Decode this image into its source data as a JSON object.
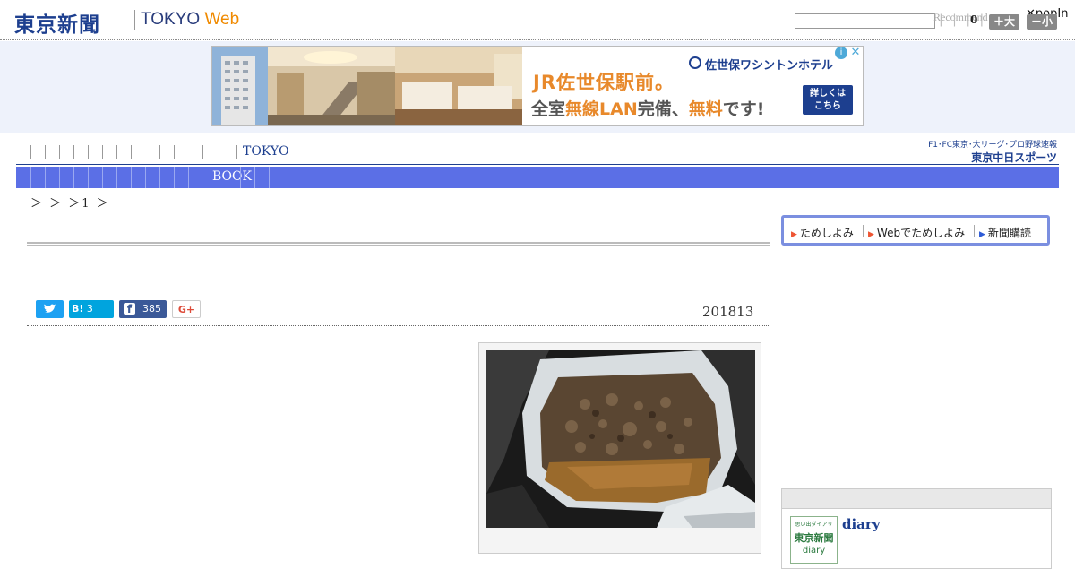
{
  "header": {
    "logo_text": "東京新聞",
    "logo_sub_main": "TOKYO ",
    "logo_sub_accent": "Web",
    "recommend_label": "Recommend",
    "recommend_count": "0",
    "popin_label": "popIn",
    "size_plus_label": "＋大",
    "size_minus_label": "－小"
  },
  "ad": {
    "title": "JR佐世保駅前。",
    "hotel_name": "佐世保ワシントンホテル",
    "line_prefix": "全室",
    "line_hl1": "無線LAN",
    "line_mid": "完備、",
    "line_hl2": "無料",
    "line_suffix": "です!",
    "more_line1": "詳しくは",
    "more_line2": "こちら",
    "choice_icon": "i",
    "close_icon": "✕"
  },
  "nav": {
    "tokyo_label": "TOKYO",
    "book_label": "BOOK",
    "chunichi_top": "F1･FC東京･大リーグ･プロ野球速報",
    "chunichi_bottom": "東京中日スポーツ"
  },
  "breadcrumb": "＞ ＞ ＞1 ＞",
  "subscribe": {
    "item1": "ためしよみ",
    "item2": "Webでためしよみ",
    "item3": "新聞購読"
  },
  "share": {
    "twitter_icon": "bird-icon",
    "hatena_label": "B!",
    "hatena_count": "3",
    "facebook_count": "385",
    "gplus_label": "G+"
  },
  "article": {
    "date": "201813"
  },
  "sidebar": {
    "diary_title": "diary",
    "thumb_line1": "東京新聞",
    "thumb_line2": "diary",
    "thumb_top": "思い出ダイアリ"
  },
  "colors": {
    "brand_blue": "#1d3f8f",
    "nav_blue": "#5b6fe6",
    "accent_orange": "#e8892b",
    "twitter": "#1da1f2",
    "hatena": "#00a4de",
    "facebook": "#3b5998"
  }
}
